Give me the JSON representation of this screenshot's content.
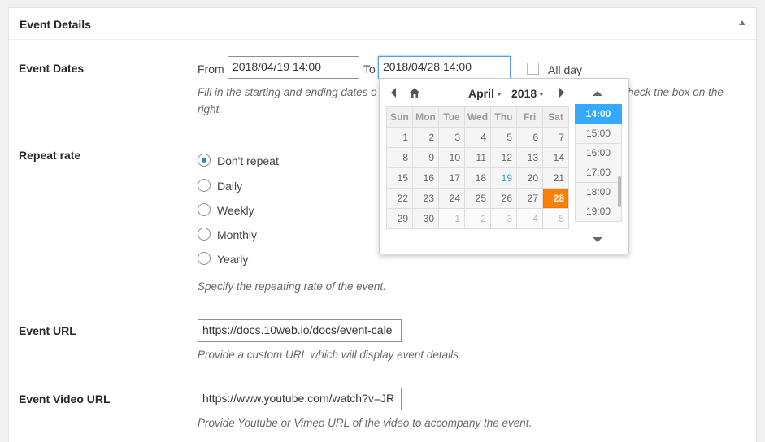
{
  "panel": {
    "title": "Event Details"
  },
  "event_dates": {
    "label": "Event Dates",
    "from_label": "From",
    "from_value": "2018/04/19 14:00",
    "to_label": "To",
    "to_value": "2018/04/28 14:00",
    "all_day_label": "All day",
    "description_line1": "Fill in the starting and ending dates o",
    "description_line1_right": "heck the box on the",
    "description_line2": "right."
  },
  "datepicker": {
    "month": "April",
    "year": "2018",
    "weekdays": [
      "Sun",
      "Mon",
      "Tue",
      "Wed",
      "Thu",
      "Fri",
      "Sat"
    ],
    "weeks": [
      [
        "1",
        "2",
        "3",
        "4",
        "5",
        "6",
        "7"
      ],
      [
        "8",
        "9",
        "10",
        "11",
        "12",
        "13",
        "14"
      ],
      [
        "15",
        "16",
        "17",
        "18",
        "19",
        "20",
        "21"
      ],
      [
        "22",
        "23",
        "24",
        "25",
        "26",
        "27",
        "28"
      ],
      [
        "29",
        "30",
        "1",
        "2",
        "3",
        "4",
        "5"
      ]
    ],
    "today": "19",
    "selected": "28",
    "times": [
      "14:00",
      "15:00",
      "16:00",
      "17:00",
      "18:00",
      "19:00"
    ],
    "selected_time": "14:00",
    "colors": {
      "selected_day": "#ff8000",
      "today": "#3a97d4",
      "selected_time": "#33aaff"
    }
  },
  "repeat": {
    "label": "Repeat rate",
    "options": [
      "Don't repeat",
      "Daily",
      "Weekly",
      "Monthly",
      "Yearly"
    ],
    "selected": "Don't repeat",
    "description": "Specify the repeating rate of the event."
  },
  "event_url": {
    "label": "Event URL",
    "value": "https://docs.10web.io/docs/event-cale",
    "description": "Provide a custom URL which will display event details."
  },
  "video_url": {
    "label": "Event Video URL",
    "value": "https://www.youtube.com/watch?v=JR",
    "description": "Provide Youtube or Vimeo URL of the video to accompany the event."
  }
}
